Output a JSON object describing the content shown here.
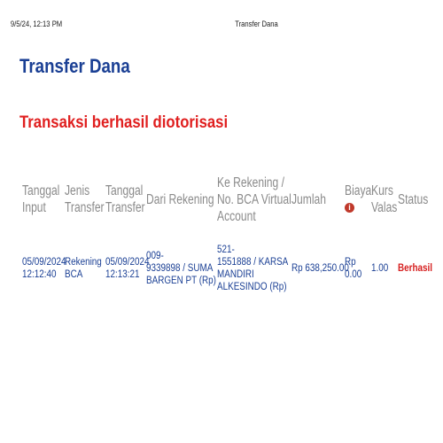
{
  "print_header": {
    "datetime": "9/5/24, 12:13 PM",
    "title": "Transfer Dana"
  },
  "page": {
    "title": "Transfer Dana",
    "success_message": "Transaksi berhasil diotorisasi"
  },
  "table": {
    "headers": {
      "tanggal_input": [
        "Tanggal",
        "Input"
      ],
      "jenis_transfer": [
        "Jenis",
        "Transfer"
      ],
      "tanggal_transfer": [
        "Tanggal",
        "Transfer"
      ],
      "dari_rekening": [
        "Dari Rekening"
      ],
      "ke_rekening": [
        "Ke Rekening /",
        "No. BCA Virtual",
        "Account"
      ],
      "jumlah": [
        "Jumlah"
      ],
      "biaya": [
        "Biaya"
      ],
      "kurs_valas": [
        "Kurs",
        "Valas"
      ],
      "status": [
        "Status"
      ]
    },
    "biaya_info_icon": "info-icon",
    "rows": [
      {
        "tanggal_input": [
          "05/09/2024",
          "12:12:40"
        ],
        "jenis_transfer": [
          "Rekening",
          "BCA"
        ],
        "tanggal_transfer": [
          "05/09/2024",
          "12:13:21"
        ],
        "dari_rekening": [
          "009-",
          "9339898 / SUMA",
          "BARGEN PT (Rp)"
        ],
        "ke_rekening": [
          "521-",
          "1551888 / KARSA",
          "MANDIRI",
          "ALKESINDO (Rp)"
        ],
        "jumlah": "Rp 638,250.00",
        "biaya": [
          "Rp",
          "0.00"
        ],
        "kurs_valas": "1.00",
        "status": "Berhasil"
      }
    ]
  },
  "colors": {
    "title_blue": "#1a3f94",
    "success_red": "#e01f1f",
    "header_gray": "#8a8a8a"
  }
}
